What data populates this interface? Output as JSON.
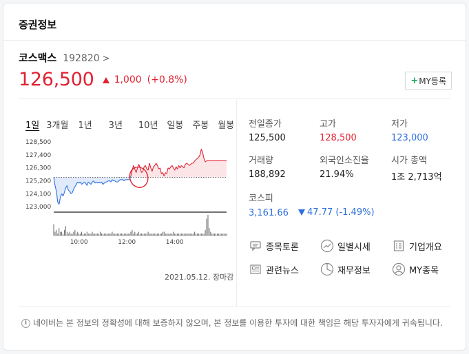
{
  "header": {
    "title": "증권정보"
  },
  "stock": {
    "name": "코스맥스",
    "code": "192820",
    "code_chevron": ">",
    "price": "126,500",
    "change": "1,000",
    "change_pct": "(+0.8%)",
    "my_button": "MY등록",
    "my_button_plus": "+"
  },
  "chart_tabs": [
    {
      "label": "1일",
      "active": true
    },
    {
      "label": "3개월",
      "active": false
    },
    {
      "label": "1년",
      "active": false
    },
    {
      "label": "3년",
      "active": false
    },
    {
      "label": "10년",
      "active": false
    },
    {
      "label": "일봉",
      "active": false
    },
    {
      "label": "주봉",
      "active": false
    },
    {
      "label": "월봉",
      "active": false
    }
  ],
  "chart_data": {
    "type": "line",
    "title": "",
    "xlabel": "",
    "ylabel": "",
    "y_ticks": [
      "128,500",
      "127,400",
      "126,300",
      "125,200",
      "124,100",
      "123,000"
    ],
    "x_ticks": [
      "10:00",
      "12:00",
      "14:00"
    ],
    "ylim": [
      122600,
      128800
    ],
    "baseline": 125500,
    "above_color": "#e02232",
    "below_color": "#2d6fdf",
    "x": [
      0,
      3,
      6,
      9,
      12,
      15,
      18,
      21,
      24,
      27,
      30,
      33,
      36,
      39,
      42,
      45,
      48,
      51,
      54,
      57,
      60,
      63,
      66,
      69,
      72,
      75,
      78,
      81,
      84,
      87,
      90,
      93,
      96,
      99,
      102,
      105,
      108,
      111,
      114,
      117,
      120,
      123,
      126,
      129,
      132,
      135,
      138,
      141,
      144,
      147,
      150,
      153,
      156,
      159,
      162,
      165,
      168,
      171,
      174,
      177,
      180,
      183,
      186,
      189,
      192,
      195,
      198,
      201,
      204,
      207,
      210,
      213,
      216,
      219,
      222,
      225,
      228,
      231,
      234,
      237,
      240,
      243,
      246,
      249,
      252,
      255,
      258,
      261,
      264,
      267,
      270,
      273,
      276,
      279,
      282,
      285,
      288,
      291,
      294,
      297,
      300,
      303,
      306,
      309,
      312,
      315,
      318,
      321,
      324,
      327,
      330,
      333,
      336,
      339,
      342,
      345,
      348,
      351,
      354,
      357,
      360,
      363,
      366,
      369,
      372,
      375,
      378,
      381,
      384,
      387,
      390
    ],
    "y": [
      125500,
      124800,
      124300,
      123400,
      123200,
      123800,
      124100,
      123900,
      124200,
      124600,
      124800,
      124400,
      124300,
      124100,
      124200,
      124500,
      124700,
      124900,
      125100,
      125000,
      125100,
      124900,
      125000,
      125100,
      125000,
      124800,
      125100,
      125000,
      124900,
      125100,
      125200,
      125000,
      125100,
      125000,
      125100,
      125000,
      125100,
      124900,
      125000,
      125100,
      125100,
      125200,
      125200,
      125100,
      125300,
      125200,
      125200,
      125100,
      125100,
      125200,
      125300,
      125300,
      125300,
      125200,
      125300,
      125300,
      125300,
      125300,
      125600,
      126100,
      126500,
      126200,
      125900,
      126300,
      126600,
      126300,
      125900,
      126000,
      126400,
      126500,
      126200,
      126100,
      126700,
      126300,
      126000,
      126400,
      126500,
      126700,
      126500,
      126200,
      126300,
      125800,
      125900,
      125600,
      125900,
      125800,
      126300,
      126200,
      126400,
      126500,
      126300,
      126100,
      126400,
      126200,
      126500,
      126300,
      126500,
      126400,
      126300,
      126600,
      126700,
      126600,
      126500,
      126600,
      126700,
      126700,
      126900,
      127000,
      127100,
      127200,
      127400,
      127900,
      127600,
      127100,
      126800,
      126900,
      126900,
      126900,
      126900,
      126900,
      126900,
      126900,
      126900,
      126900,
      126900,
      126900,
      126900,
      126900,
      126900,
      126900,
      126900
    ],
    "volume": [
      6,
      2,
      3,
      1,
      4,
      2,
      2,
      1,
      3,
      5,
      2,
      1,
      2,
      1,
      1,
      2,
      3,
      1,
      2,
      1,
      1,
      2,
      1,
      1,
      1,
      2,
      1,
      1,
      1,
      2,
      1,
      1,
      1,
      1,
      1,
      2,
      1,
      1,
      1,
      1,
      1,
      1,
      1,
      1,
      2,
      1,
      1,
      1,
      1,
      1,
      1,
      1,
      1,
      1,
      1,
      1,
      1,
      1,
      2,
      3,
      1,
      2,
      1,
      1,
      2,
      1,
      1,
      1,
      1,
      1,
      1,
      2,
      1,
      1,
      1,
      1,
      1,
      1,
      1,
      1,
      1,
      1,
      2,
      2,
      1,
      1,
      1,
      1,
      1,
      1,
      2,
      1,
      1,
      1,
      1,
      1,
      1,
      1,
      1,
      1,
      1,
      1,
      1,
      1,
      1,
      1,
      2,
      1,
      1,
      1,
      1,
      1,
      1,
      1,
      3,
      9,
      11,
      4,
      2,
      1,
      1,
      1,
      1,
      1,
      1,
      1,
      1,
      1,
      1,
      1,
      1
    ]
  },
  "chart_date": "2021.05.12. 장마감",
  "info": {
    "prev_close_label": "전일종가",
    "prev_close": "125,500",
    "high_label": "고가",
    "high": "128,500",
    "low_label": "저가",
    "low": "123,000",
    "volume_label": "거래량",
    "volume": "188,892",
    "foreign_label": "외국인소진율",
    "foreign": "21.94%",
    "mcap_label": "시가 총액",
    "mcap": "1조 2,713억",
    "kospi_label": "코스피",
    "kospi_value": "3,161.66",
    "kospi_change": "47.77 (-1.49%)"
  },
  "links": {
    "forum": "종목토론",
    "daily": "일별시세",
    "company": "기업개요",
    "news": "관련뉴스",
    "finance": "재무정보",
    "my": "MY종목"
  },
  "disclaimer": "네이버는 본 정보의 정확성에 대해 보증하지 않으며, 본 정보를 이용한 투자에 대한 책임은 해당 투자자에게 귀속됩니다.",
  "disclaimer_icon": "i",
  "colors": {
    "up": "#e02232",
    "down": "#2d6fdf",
    "plus": "#19a25b"
  }
}
